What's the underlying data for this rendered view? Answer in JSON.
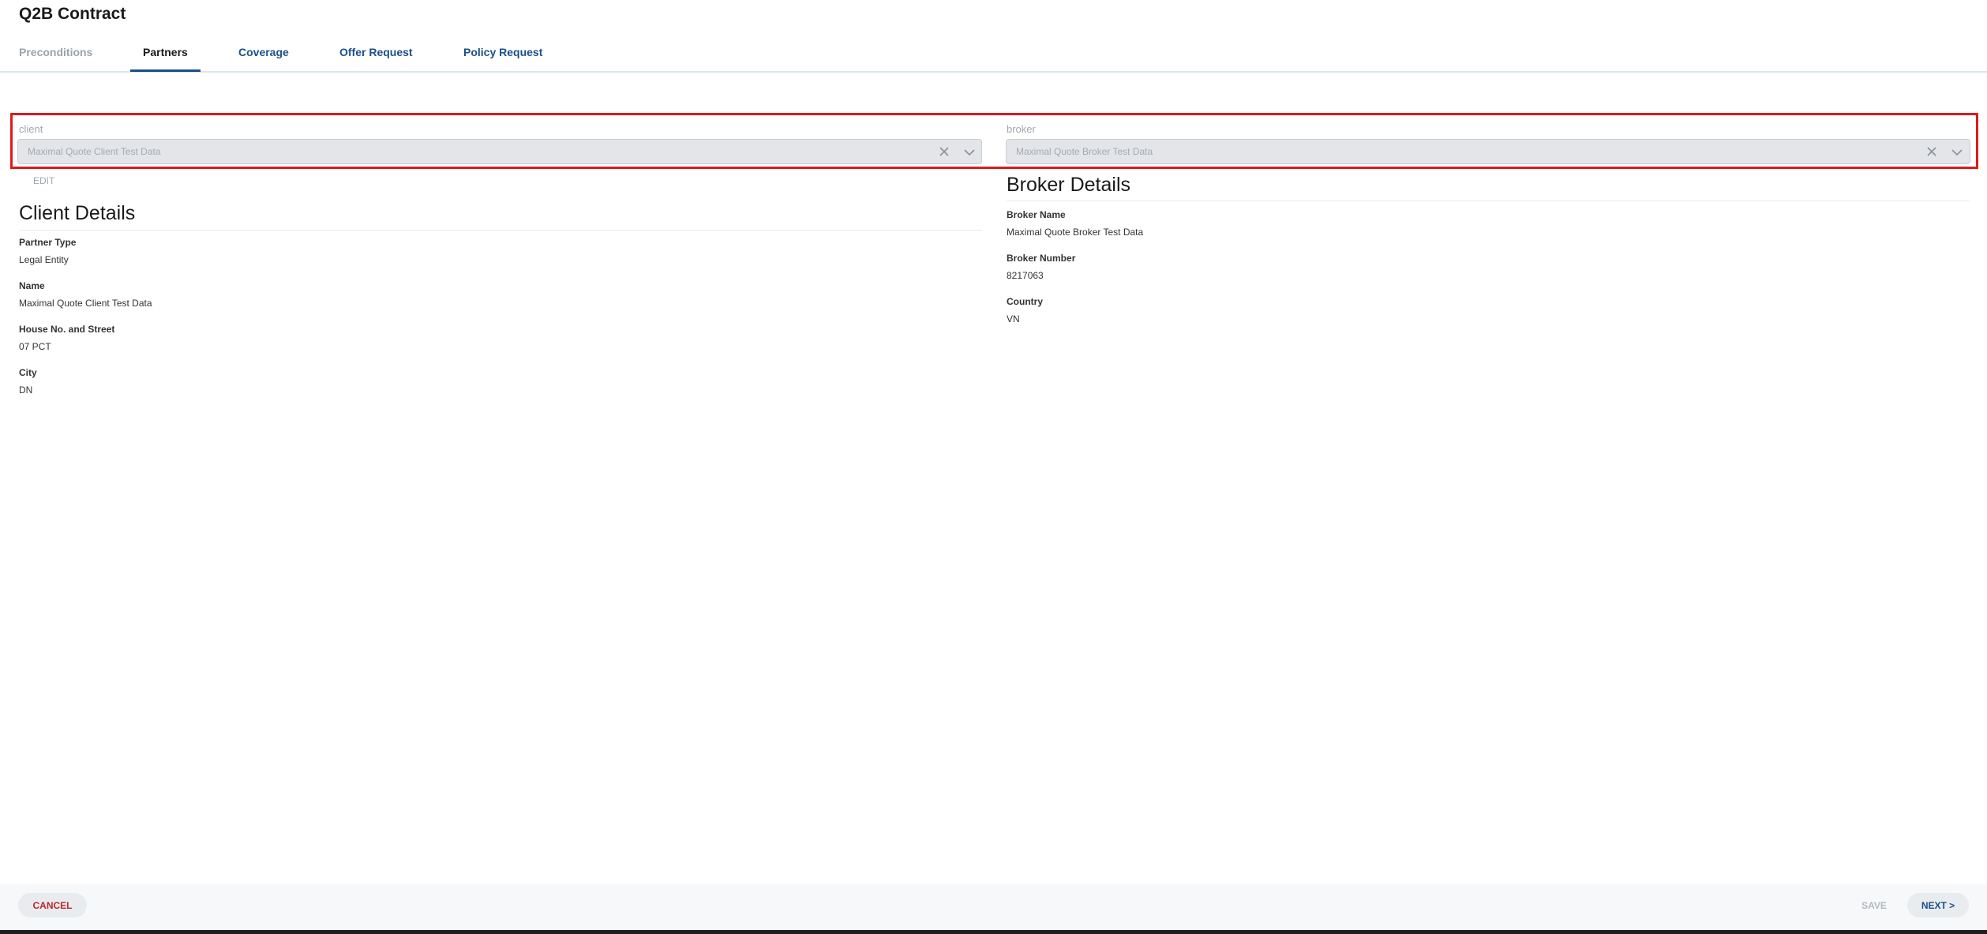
{
  "page": {
    "title": "Q2B Contract"
  },
  "tabs": [
    {
      "label": "Preconditions",
      "state": "disabled"
    },
    {
      "label": "Partners",
      "state": "active"
    },
    {
      "label": "Coverage",
      "state": "default"
    },
    {
      "label": "Offer Request",
      "state": "default"
    },
    {
      "label": "Policy Request",
      "state": "default"
    }
  ],
  "client_field": {
    "label": "client",
    "value": "Maximal Quote Client Test Data",
    "clear_icon": "close-icon",
    "dropdown_icon": "chevron-down-icon"
  },
  "broker_field": {
    "label": "broker",
    "value": "Maximal Quote Broker Test Data",
    "clear_icon": "close-icon",
    "dropdown_icon": "chevron-down-icon"
  },
  "edit_label": "EDIT",
  "client_details": {
    "title": "Client Details",
    "fields": [
      {
        "label": "Partner Type",
        "value": "Legal Entity"
      },
      {
        "label": "Name",
        "value": "Maximal Quote Client Test Data"
      },
      {
        "label": "House No. and Street",
        "value": "07 PCT"
      },
      {
        "label": "City",
        "value": "DN"
      }
    ]
  },
  "broker_details": {
    "title": "Broker Details",
    "fields": [
      {
        "label": "Broker Name",
        "value": "Maximal Quote Broker Test Data"
      },
      {
        "label": "Broker Number",
        "value": "8217063"
      },
      {
        "label": "Country",
        "value": "VN"
      }
    ]
  },
  "footer": {
    "cancel_label": "CANCEL",
    "save_label": "SAVE",
    "next_label": "NEXT >"
  },
  "colors": {
    "accent": "#1a4f8a",
    "highlight": "#e01a1a",
    "cancel": "#c0262d",
    "disabled": "#9aa4ad"
  }
}
